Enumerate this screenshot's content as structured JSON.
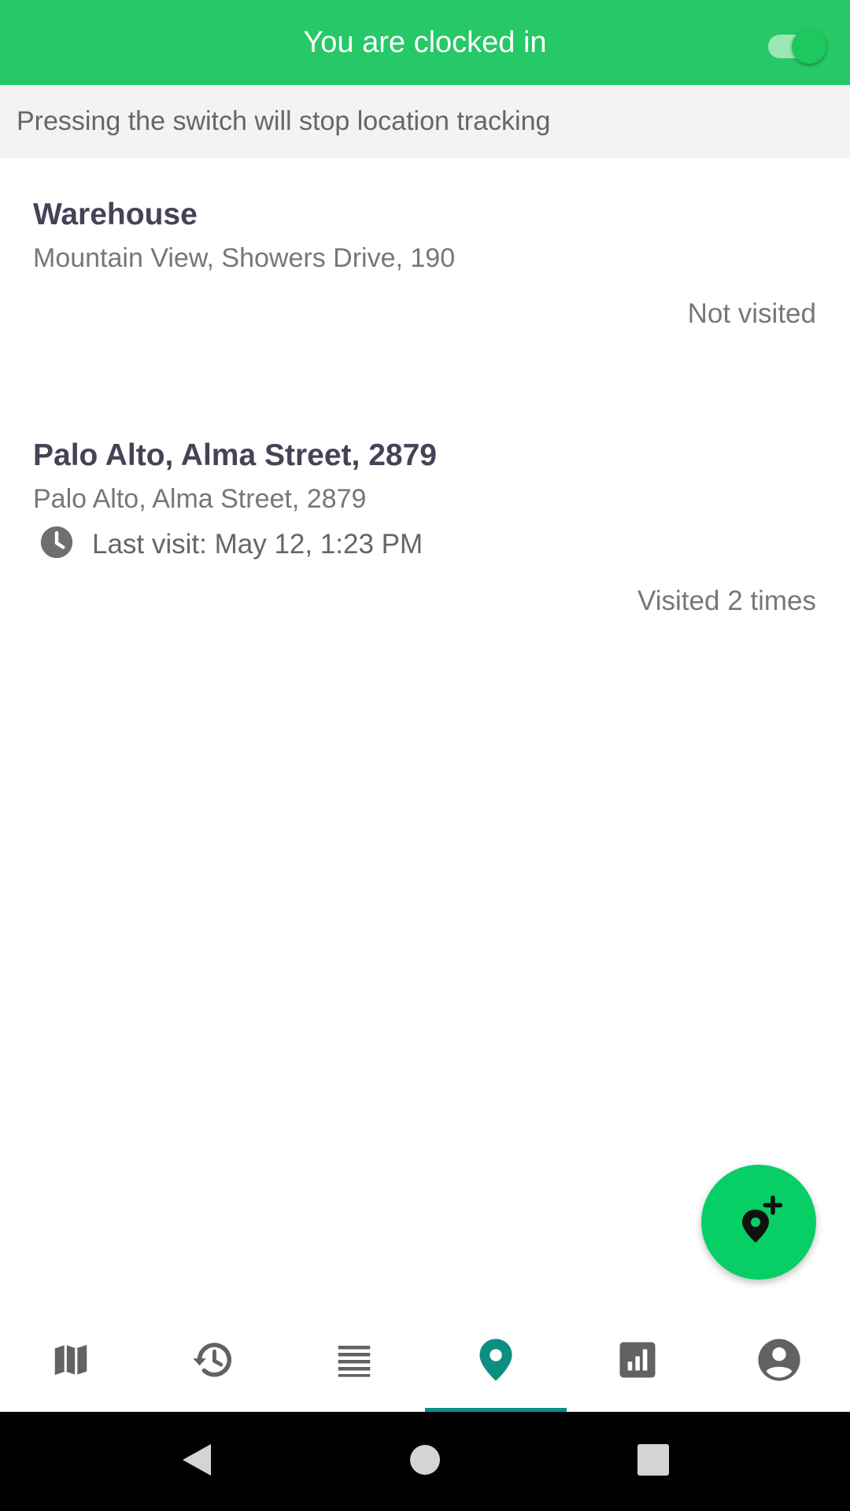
{
  "header": {
    "title": "You are clocked in",
    "toggle_on": true,
    "accent": "#26c867"
  },
  "notice": {
    "text": "Pressing the switch will stop location tracking"
  },
  "places": [
    {
      "title": "Warehouse",
      "address": "Mountain View,  Showers Drive, 190",
      "status": "Not visited"
    },
    {
      "title": "Palo Alto,  Alma Street, 2879",
      "address": "Palo Alto,  Alma Street, 2879",
      "last_visit": "Last visit: May 12, 1:23 PM",
      "status": "Visited 2 times"
    }
  ],
  "fab": {
    "icon": "add-location-icon",
    "color": "#08cf65"
  },
  "bottom_nav": {
    "items": [
      {
        "icon": "map-icon"
      },
      {
        "icon": "history-icon"
      },
      {
        "icon": "list-icon"
      },
      {
        "icon": "place-icon",
        "active": true
      },
      {
        "icon": "stats-icon"
      },
      {
        "icon": "account-icon"
      }
    ],
    "active_color": "#0c8f83"
  },
  "system_nav": {
    "buttons": [
      "back-icon",
      "home-icon",
      "recents-icon"
    ]
  }
}
